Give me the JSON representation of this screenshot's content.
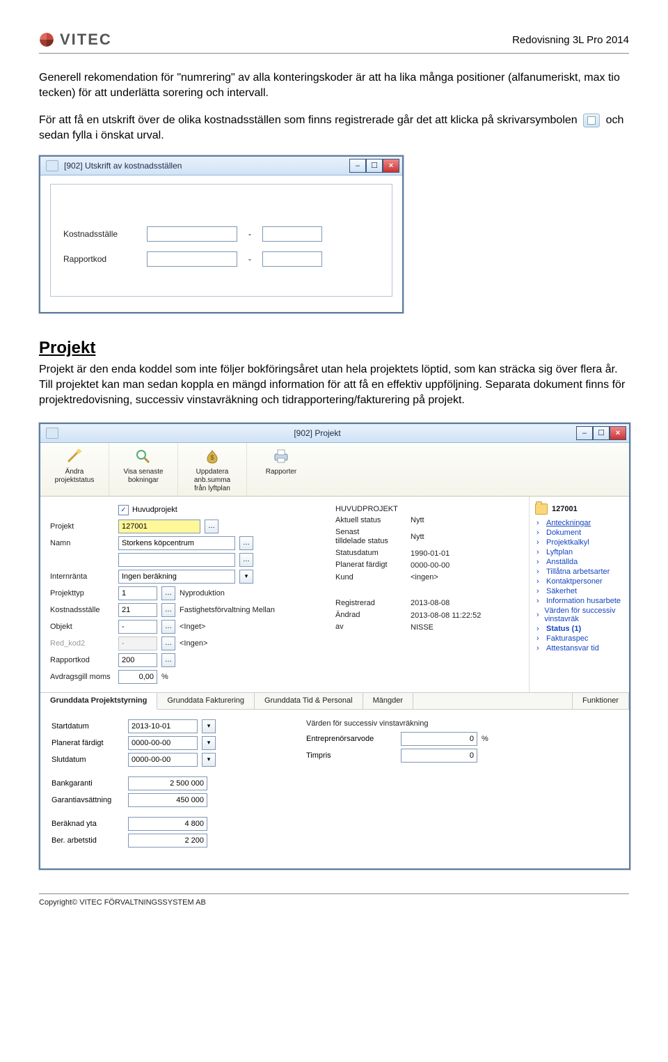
{
  "header": {
    "brand": "VITEC",
    "title": "Redovisning 3L Pro 2014"
  },
  "paragraphs": {
    "p1": "Generell rekomendation för \"numrering\" av alla konteringskoder är att ha lika många positioner (alfanumeriskt, max tio tecken) för att underlätta sorering och intervall.",
    "p2a": "För att få en utskrift över de olika kostnadsställen som finns registrerade går det att klicka på skrivarsymbolen ",
    "p2b": " och sedan fylla i önskat urval."
  },
  "win1": {
    "title": "[902]  Utskrift av kostnadsställen",
    "rows": {
      "l1": "Kostnadsställe",
      "l2": "Rapportkod"
    }
  },
  "section": {
    "title": "Projekt",
    "text": "Projekt är den enda koddel som inte följer bokföringsåret utan hela projektets löptid, som kan sträcka sig över flera år. Till projektet kan man sedan koppla en mängd information för att få en effektiv uppföljning. Separata dokument finns för projektredovisning, successiv vinstavräkning och tidrapportering/fakturering på projekt."
  },
  "win2": {
    "title": "[902]  Projekt",
    "toolbar": [
      {
        "label": "Ändra\nprojektstatus"
      },
      {
        "label": "Visa senaste\nbokningar"
      },
      {
        "label": "Uppdatera\nanb.summa\nfrån lyftplan"
      },
      {
        "label": "Rapporter"
      }
    ],
    "form": {
      "huvudprojekt_chk": true,
      "huvudprojekt_lbl": "Huvudprojekt",
      "projekt_lbl": "Projekt",
      "projekt_val": "127001",
      "namn_lbl": "Namn",
      "namn_val": "Storkens köpcentrum",
      "internranta_lbl": "Internränta",
      "internranta_val": "Ingen beräkning",
      "projekttyp_lbl": "Projekttyp",
      "projekttyp_val": "1",
      "projekttyp_txt": "Nyproduktion",
      "kostnadsstalle_lbl": "Kostnadsställe",
      "kostnadsstalle_val": "21",
      "kostnadsstalle_txt": "Fastighetsförvaltning Mellan",
      "objekt_lbl": "Objekt",
      "objekt_val": "-",
      "objekt_txt": "<Inget>",
      "redkod2_lbl": "Red_kod2",
      "redkod2_val": "-",
      "redkod2_txt": "<Ingen>",
      "rapportkod_lbl": "Rapportkod",
      "rapportkod_val": "200",
      "avdragsgill_lbl": "Avdragsgill moms",
      "avdragsgill_val": "0,00",
      "avdragsgill_suffix": "%"
    },
    "mid": {
      "hp": "HUVUDPROJEKT",
      "aktuell_lbl": "Aktuell status",
      "aktuell_val": "Nytt",
      "senast_lbl": "Senast\ntilldelade status",
      "senast_val": "Nytt",
      "statusdatum_lbl": "Statusdatum",
      "statusdatum_val": "1990-01-01",
      "planerat_lbl": "Planerat färdigt",
      "planerat_val": "0000-00-00",
      "kund_lbl": "Kund",
      "kund_val": "<ingen>",
      "reg_lbl": "Registrerad",
      "reg_val": "2013-08-08",
      "andrad_lbl": "Ändrad",
      "andrad_val": "2013-08-08 11:22:52",
      "av_lbl": "av",
      "av_val": "NISSE"
    },
    "tree": {
      "root": "127001",
      "items": [
        {
          "label": "Anteckningar",
          "ul": true
        },
        {
          "label": "Dokument"
        },
        {
          "label": "Projektkalkyl"
        },
        {
          "label": "Lyftplan"
        },
        {
          "label": "Anställda"
        },
        {
          "label": "Tillåtna arbetsarter"
        },
        {
          "label": "Kontaktpersoner"
        },
        {
          "label": "Säkerhet"
        },
        {
          "label": "Information husarbete"
        },
        {
          "label": "Värden för successiv vinstavräk"
        },
        {
          "label": "Status (1)",
          "bold": true
        },
        {
          "label": "Fakturaspec"
        },
        {
          "label": "Attestansvar tid"
        }
      ]
    },
    "tabs": [
      "Grunddata Projektstyrning",
      "Grunddata Fakturering",
      "Grunddata Tid & Personal",
      "Mängder",
      "Funktioner"
    ],
    "tabpanel": {
      "start_lbl": "Startdatum",
      "start_val": "2013-10-01",
      "planerat_lbl": "Planerat färdigt",
      "planerat_val": "0000-00-00",
      "slut_lbl": "Slutdatum",
      "slut_val": "0000-00-00",
      "bank_lbl": "Bankgaranti",
      "bank_val": "2 500 000",
      "garanti_lbl": "Garantiavsättning",
      "garanti_val": "450 000",
      "yta_lbl": "Beräknad yta",
      "yta_val": "4 800",
      "arbets_lbl": "Ber. arbetstid",
      "arbets_val": "2 200",
      "succ_head": "Värden för successiv vinstavräkning",
      "entr_lbl": "Entreprenörsarvode",
      "entr_val": "0",
      "entr_suffix": "%",
      "timpris_lbl": "Timpris",
      "timpris_val": "0"
    }
  },
  "footer": {
    "text": "Copyright© VITEC FÖRVALTNINGSSYSTEM AB"
  }
}
